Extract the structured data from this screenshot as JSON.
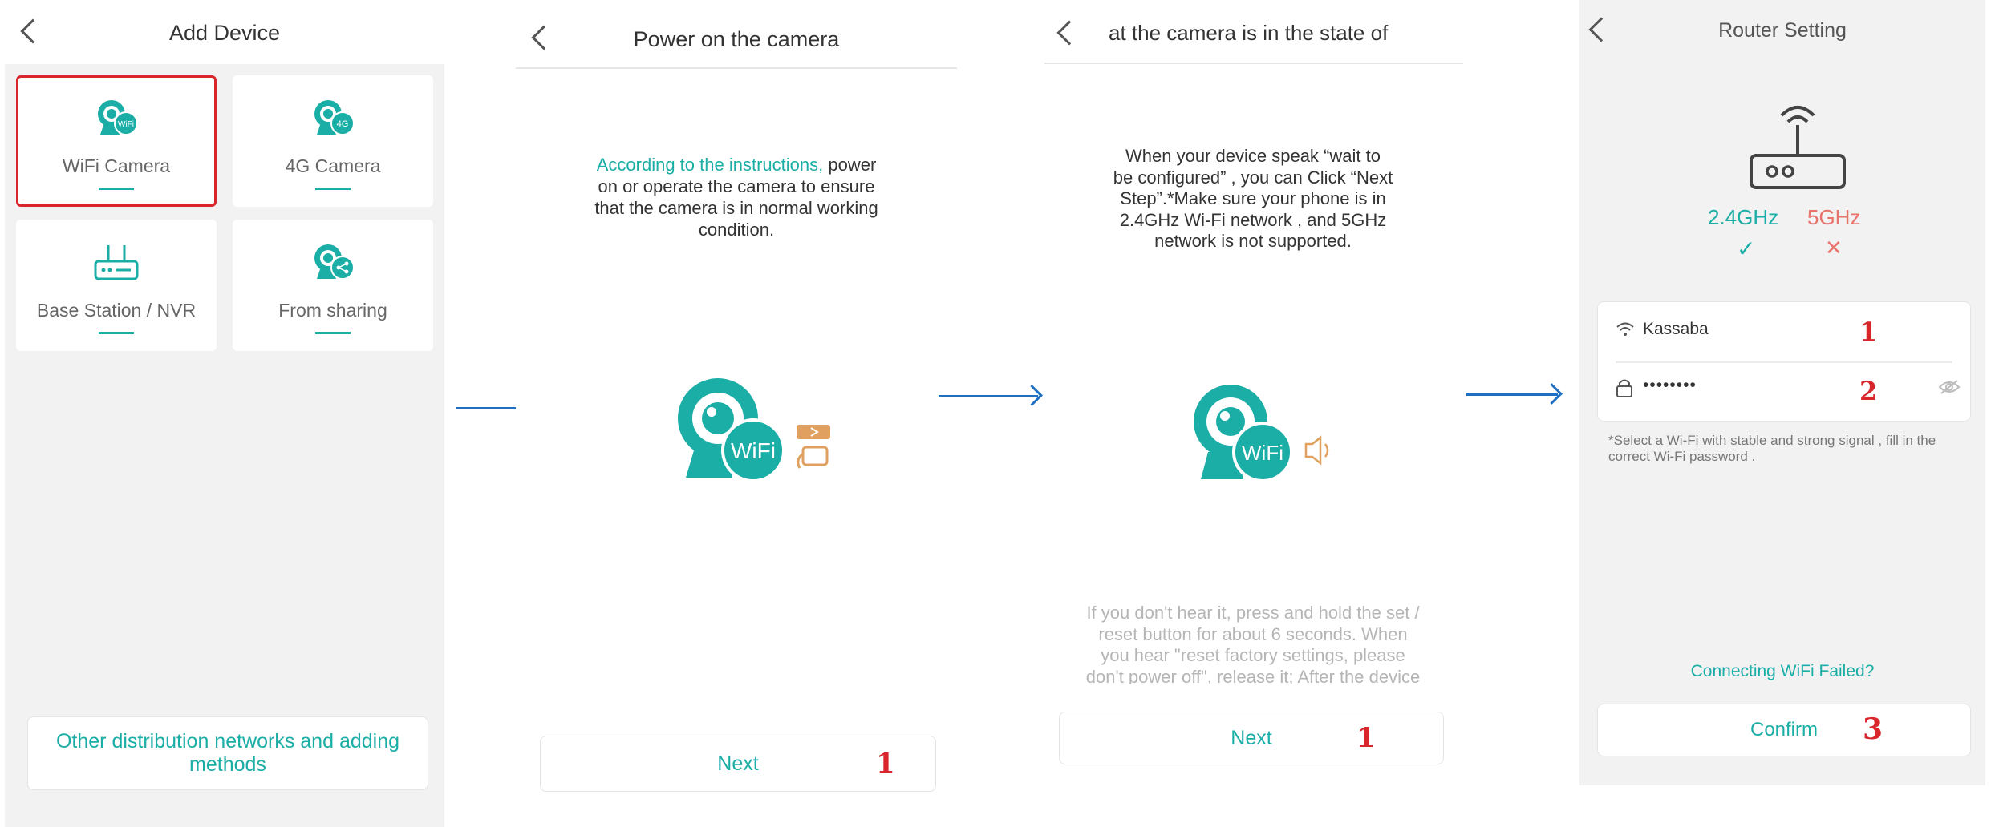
{
  "colors": {
    "accent": "#1aaea6",
    "highlight": "#d8262c",
    "arrow": "#1f6fc2",
    "orange": "#e0a060"
  },
  "panel1": {
    "title": "Add Device",
    "cards": [
      {
        "label": "WiFi Camera",
        "icon": "wifi-camera-icon",
        "badge": "WiFi",
        "selected": true
      },
      {
        "label": "4G Camera",
        "icon": "4g-camera-icon",
        "badge": "4G"
      },
      {
        "label": "Base Station / NVR",
        "icon": "base-station-icon"
      },
      {
        "label": "From sharing",
        "icon": "share-camera-icon"
      }
    ],
    "other_button_line1": "Other distribution networks and adding",
    "other_button_line2": "methods"
  },
  "panel2": {
    "title": "Power on the camera",
    "instruction_link": "According to the instructions,",
    "instruction_rest_1": "power",
    "instruction_rest_2": "on or operate the camera to ensure",
    "instruction_rest_3": "that the camera is in normal working",
    "instruction_rest_4": "condition.",
    "wifi_badge": "WiFi",
    "next_label": "Next",
    "step_num": "1"
  },
  "panel3": {
    "title": "at the camera is in the state of",
    "desc_1": "When your device speak “wait to",
    "desc_2": "be configured” , you can Click “Next",
    "desc_3": "Step”.*Make sure your phone is in",
    "desc_4": "2.4GHz Wi-Fi network , and 5GHz",
    "desc_5": "network is not supported.",
    "wifi_badge": "WiFi",
    "hint_1": "If you don't hear it, press and hold the set /",
    "hint_2": "reset button for about 6 seconds. When",
    "hint_3": "you hear \"reset factory settings, please",
    "hint_4": "don't power off\", release it; After the device",
    "next_label": "Next",
    "step_num": "1"
  },
  "panel4": {
    "title": "Router Setting",
    "band_ok": "2.4GHz",
    "band_ok_mark": "✓",
    "band_bad": "5GHz",
    "band_bad_mark": "✕",
    "ssid": "Kassaba",
    "password_mask": "••••••••",
    "step_ssid": "1",
    "step_password": "2",
    "note_1": "*Select a Wi-Fi with stable and strong signal , fill in the",
    "note_2": "correct Wi-Fi password .",
    "failed_link": "Connecting WiFi Failed?",
    "confirm_label": "Confirm",
    "step_confirm": "3"
  }
}
